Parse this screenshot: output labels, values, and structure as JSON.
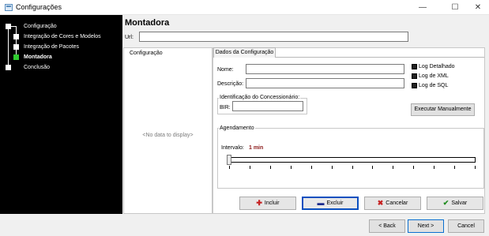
{
  "window": {
    "title": "Configurações",
    "minimize_glyph": "—",
    "maximize_glyph": "☐",
    "close_glyph": "✕"
  },
  "sidebar": {
    "items": [
      {
        "label": "Configuração",
        "current": false
      },
      {
        "label": "Integração de Cores e Modelos",
        "current": false
      },
      {
        "label": "Integração de Pacotes",
        "current": false
      },
      {
        "label": "Montadora",
        "current": true
      },
      {
        "label": "Conclusão",
        "current": false
      }
    ]
  },
  "page": {
    "heading": "Montadora",
    "url_label": "Url:",
    "url_value": ""
  },
  "left_panel": {
    "header": "Configuração",
    "empty_text": "<No data to display>"
  },
  "config": {
    "tab_label": "Dados da Configuração",
    "nome_label": "Nome:",
    "nome_value": "",
    "descricao_label": "Descrição:",
    "descricao_value": "",
    "checkboxes": [
      {
        "label": "Log Detalhado",
        "checked": true
      },
      {
        "label": "Log de XML",
        "checked": true
      },
      {
        "label": "Log de SQL",
        "checked": true
      }
    ],
    "concessionario_group": "Identificação do Concessionário:",
    "bir_label": "BIR:",
    "bir_value": "",
    "execute_button": "Executar Manualmente",
    "agendamento_group": "Agendamento",
    "interval_label": "Intervalo:",
    "interval_value": "1 min",
    "interval_slider_fraction": 0.0
  },
  "actions": {
    "incluir": "Incluir",
    "excluir": "Excluir",
    "cancelar": "Cancelar",
    "salvar": "Salvar"
  },
  "wizard": {
    "back": "< Back",
    "next": "Next >",
    "cancel": "Cancel"
  },
  "colors": {
    "sidebar_bg": "#000000",
    "current_node": "#2fcc2f",
    "interval_value": "#8b1a1a",
    "focus_border": "#0b4fbf"
  }
}
